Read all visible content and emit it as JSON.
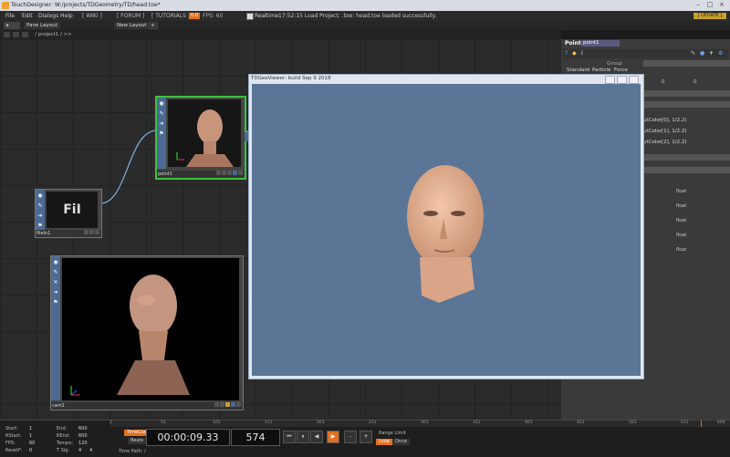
{
  "titlebar": {
    "title": "TouchDesigner: W:/projects/TDGeometry/TD/head.toe*"
  },
  "menu": {
    "items": [
      "File",
      "Edit",
      "Dialogs",
      "Help"
    ],
    "links": [
      "[ WIKI ]",
      "[ FORUM ]",
      "[ TUTORIALS ]"
    ],
    "cpu": "0.0",
    "fps": "FPS: 60",
    "realtime": "Realtime",
    "status": "17:52:15 Load Project: .toe: head.toe loaded successfully.",
    "update": "[ UPDATE ]"
  },
  "panes": {
    "pane_layout": "Pane Layout",
    "new_layout": "New Layout"
  },
  "path": {
    "text": "/ project1 / >>"
  },
  "nodes": {
    "point1": "point1",
    "filein": "fileIn1",
    "filein_tile": "FiI",
    "cam": "cam1"
  },
  "params": {
    "type": "Point",
    "name": "point1",
    "group_label": "Group",
    "tabs": [
      "Standard",
      "Particle",
      "Force"
    ],
    "zero1": "0",
    "zero2": "0",
    "rows": [
      "utColor[0], 1/2.2)",
      "utColor[1], 1/2.2)",
      "utColor[2], 1/2.2)"
    ],
    "float_labels": [
      "float",
      "float",
      "float",
      "float",
      "float"
    ]
  },
  "viewer": {
    "title": "TDGeoViewer: build Sep  9 2018"
  },
  "timeline": {
    "start_label": "Start:",
    "start": "1",
    "end_label": "End:",
    "end": "600",
    "rstart_label": "RStart:",
    "rstart": "1",
    "rend_label": "REnd:",
    "rend": "600",
    "fps_label": "FPS:",
    "fps": "60",
    "tempo_label": "Tempo:",
    "tempo": "120",
    "resetf_label": "ResetF:",
    "resetf": "0",
    "tsig_label": "T Sig:",
    "tsig1": "4",
    "tsig2": "4",
    "timecode_btn": "TimeCode",
    "beats_btn": "Beats",
    "timecode": "00:00:09.33",
    "frame": "574",
    "range_limit": "Range Limit",
    "loop": "Loop",
    "once": "Once",
    "timepath": "Time Path: /",
    "ticks": [
      "1",
      "51",
      "101",
      "151",
      "201",
      "251",
      "301",
      "351",
      "401",
      "451",
      "501",
      "551",
      "600"
    ]
  }
}
